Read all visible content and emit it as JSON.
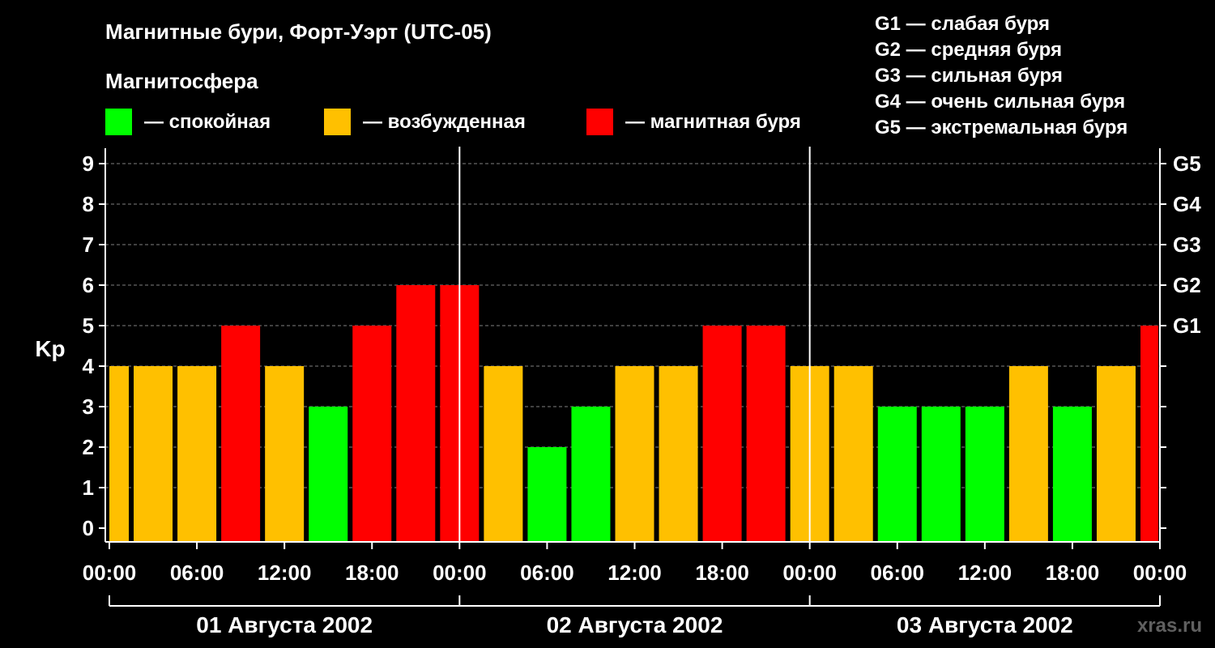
{
  "chart_data": {
    "type": "bar",
    "title": "Магнитные бури, Форт-Уэрт (UTC-05)",
    "subtitle": "Магнитосфера",
    "ylabel": "Kp",
    "ylim": [
      0,
      9
    ],
    "grid": true,
    "legend": [
      {
        "label": "— спокойная",
        "color": "#00ff00"
      },
      {
        "label": "— возбужденная",
        "color": "#ffc000"
      },
      {
        "label": "— магнитная буря",
        "color": "#ff0000"
      }
    ],
    "storm_scale": [
      "G1 — слабая буря",
      "G2 — средняя буря",
      "G3 — сильная буря",
      "G4 — очень сильная буря",
      "G5 — экстремальная буря"
    ],
    "right_axis": [
      {
        "kp": 5,
        "label": "G1"
      },
      {
        "kp": 6,
        "label": "G2"
      },
      {
        "kp": 7,
        "label": "G3"
      },
      {
        "kp": 8,
        "label": "G4"
      },
      {
        "kp": 9,
        "label": "G5"
      }
    ],
    "y_ticks": [
      0,
      1,
      2,
      3,
      4,
      5,
      6,
      7,
      8,
      9
    ],
    "x_tick_labels": [
      "00:00",
      "06:00",
      "12:00",
      "18:00",
      "00:00",
      "06:00",
      "12:00",
      "18:00",
      "00:00",
      "06:00",
      "12:00",
      "18:00",
      "00:00"
    ],
    "days": [
      "01 Августа 2002",
      "02 Августа 2002",
      "03 Августа 2002"
    ],
    "bars": [
      {
        "time": "01 Августа 2002 00:00",
        "kp": 4,
        "level": "возбужденная",
        "color": "#ffc000"
      },
      {
        "time": "01 Августа 2002 03:00",
        "kp": 4,
        "level": "возбужденная",
        "color": "#ffc000"
      },
      {
        "time": "01 Августа 2002 06:00",
        "kp": 4,
        "level": "возбужденная",
        "color": "#ffc000"
      },
      {
        "time": "01 Августа 2002 09:00",
        "kp": 5,
        "level": "магнитная буря",
        "color": "#ff0000"
      },
      {
        "time": "01 Августа 2002 12:00",
        "kp": 4,
        "level": "возбужденная",
        "color": "#ffc000"
      },
      {
        "time": "01 Августа 2002 15:00",
        "kp": 3,
        "level": "спокойная",
        "color": "#00ff00"
      },
      {
        "time": "01 Августа 2002 18:00",
        "kp": 5,
        "level": "магнитная буря",
        "color": "#ff0000"
      },
      {
        "time": "01 Августа 2002 21:00",
        "kp": 6,
        "level": "магнитная буря",
        "color": "#ff0000"
      },
      {
        "time": "02 Августа 2002 00:00",
        "kp": 6,
        "level": "магнитная буря",
        "color": "#ff0000"
      },
      {
        "time": "02 Августа 2002 03:00",
        "kp": 4,
        "level": "возбужденная",
        "color": "#ffc000"
      },
      {
        "time": "02 Августа 2002 06:00",
        "kp": 2,
        "level": "спокойная",
        "color": "#00ff00"
      },
      {
        "time": "02 Августа 2002 09:00",
        "kp": 3,
        "level": "спокойная",
        "color": "#00ff00"
      },
      {
        "time": "02 Августа 2002 12:00",
        "kp": 4,
        "level": "возбужденная",
        "color": "#ffc000"
      },
      {
        "time": "02 Августа 2002 15:00",
        "kp": 4,
        "level": "возбужденная",
        "color": "#ffc000"
      },
      {
        "time": "02 Августа 2002 18:00",
        "kp": 5,
        "level": "магнитная буря",
        "color": "#ff0000"
      },
      {
        "time": "02 Августа 2002 21:00",
        "kp": 5,
        "level": "магнитная буря",
        "color": "#ff0000"
      },
      {
        "time": "03 Августа 2002 00:00",
        "kp": 4,
        "level": "возбужденная",
        "color": "#ffc000"
      },
      {
        "time": "03 Августа 2002 03:00",
        "kp": 4,
        "level": "возбужденная",
        "color": "#ffc000"
      },
      {
        "time": "03 Августа 2002 06:00",
        "kp": 3,
        "level": "спокойная",
        "color": "#00ff00"
      },
      {
        "time": "03 Августа 2002 09:00",
        "kp": 3,
        "level": "спокойная",
        "color": "#00ff00"
      },
      {
        "time": "03 Августа 2002 12:00",
        "kp": 3,
        "level": "спокойная",
        "color": "#00ff00"
      },
      {
        "time": "03 Августа 2002 15:00",
        "kp": 4,
        "level": "возбужденная",
        "color": "#ffc000"
      },
      {
        "time": "03 Августа 2002 18:00",
        "kp": 3,
        "level": "спокойная",
        "color": "#00ff00"
      },
      {
        "time": "03 Августа 2002 21:00",
        "kp": 4,
        "level": "возбужденная",
        "color": "#ffc000"
      },
      {
        "time": "04 Августа 2002 00:00",
        "kp": 5,
        "level": "магнитная буря",
        "color": "#ff0000"
      }
    ]
  },
  "watermark": "xras.ru"
}
